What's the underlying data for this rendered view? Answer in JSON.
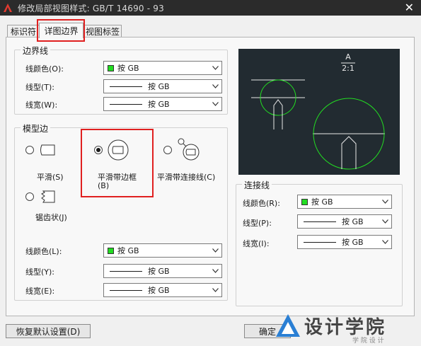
{
  "window": {
    "title": "修改局部视图样式: GB/T 14690 - 93",
    "close_glyph": "✕"
  },
  "tabs": [
    {
      "label": "标识符",
      "active": false
    },
    {
      "label": "详图边界",
      "active": true
    },
    {
      "label": "视图标签",
      "active": false
    }
  ],
  "boundary_line": {
    "title": "边界线",
    "color_label": "线颜色(O):",
    "color_value": "按 GB",
    "linetype_label": "线型(T):",
    "linetype_value": "按 GB",
    "lineweight_label": "线宽(W):",
    "lineweight_value": "按 GB"
  },
  "model_edge": {
    "title": "模型边",
    "options": [
      {
        "label": "平滑(S)",
        "checked": false
      },
      {
        "label": "平滑带边框",
        "label_line2": "(B)",
        "checked": true
      },
      {
        "label": "平滑带连接线(C)",
        "checked": false
      },
      {
        "label": "锯齿状(J)",
        "checked": false
      }
    ],
    "color_label": "线颜色(L):",
    "color_value": "按 GB",
    "linetype_label": "线型(Y):",
    "linetype_value": "按 GB",
    "lineweight_label": "线宽(E):",
    "lineweight_value": "按 GB"
  },
  "connection_line": {
    "title": "连接线",
    "color_label": "线颜色(R):",
    "color_value": "按 GB",
    "linetype_label": "线型(P):",
    "linetype_value": "按 GB",
    "lineweight_label": "线宽(I):",
    "lineweight_value": "按 GB"
  },
  "preview": {
    "label_letter": "A",
    "scale": "2:1"
  },
  "buttons": {
    "reset": "恢复默认设置(D)",
    "ok": "确定"
  },
  "watermark": {
    "text": "设计学院",
    "sub": "学 院 设 计"
  },
  "colors": {
    "swatch": "#22dd22",
    "preview_bg": "#222b31",
    "preview_green": "#22dd22",
    "highlight_red": "#e02020"
  }
}
